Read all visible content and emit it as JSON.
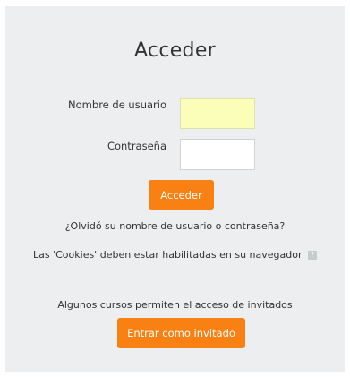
{
  "login": {
    "title": "Acceder",
    "username_label": "Nombre de usuario",
    "username_value": "",
    "password_label": "Contraseña",
    "password_value": "",
    "submit_label": "Acceder",
    "forgot_link": "¿Olvidó su nombre de usuario o contraseña?",
    "cookies_notice": "Las 'Cookies' deben estar habilitadas en su navegador",
    "help_icon": "question-icon"
  },
  "guest": {
    "notice": "Algunos cursos permiten el acceso de invitados",
    "button_label": "Entrar como invitado"
  },
  "colors": {
    "accent": "#f98012",
    "panel_background": "#eceeef",
    "autofill_background": "#fafeb9"
  }
}
